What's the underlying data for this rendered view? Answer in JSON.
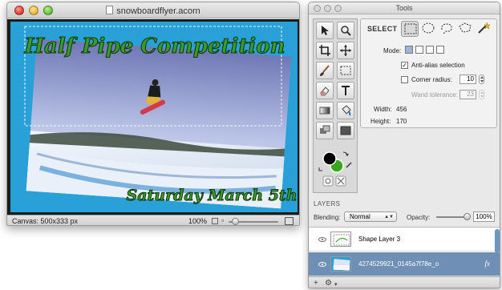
{
  "document_window": {
    "title": "snowboardflyer.acorn",
    "canvas": {
      "headline": "Half Pipe Competition",
      "subline": "Saturday March 5th",
      "headline_color": "#3a9a2a",
      "background_color": "#2aa0d8"
    },
    "status": {
      "canvas_size": "Canvas: 500x333 px",
      "zoom": "100%"
    }
  },
  "tools_window": {
    "title": "Tools",
    "tools": [
      "select-arrow",
      "zoom",
      "crop",
      "move",
      "brush",
      "marquee",
      "eraser",
      "text",
      "gradient",
      "paint-bucket",
      "clone",
      "rectangle-shape"
    ],
    "colors": {
      "foreground": "#000000",
      "background": "#3aa81e"
    },
    "options": {
      "select_label": "SELECT",
      "mode_label": "Mode:",
      "antialias_label": "Anti-alias selection",
      "antialias_checked": true,
      "corner_radius_label": "Corner radius:",
      "corner_radius_checked": false,
      "corner_radius_value": "10",
      "wand_tolerance_label": "Wand tolerance:",
      "wand_tolerance_value": "23",
      "width_label": "Width:",
      "width_value": "456",
      "height_label": "Height:",
      "height_value": "170"
    },
    "layers": {
      "title": "LAYERS",
      "blending_label": "Blending:",
      "blending_value": "Normal",
      "opacity_label": "Opacity:",
      "opacity_value": "100%",
      "items": [
        {
          "name": "Shape Layer 3",
          "selected": false
        },
        {
          "name": "4274529921_0145a7f78e_o",
          "selected": true,
          "fx": "fx"
        }
      ],
      "footer": {
        "add_label": "+",
        "gear_label": "⚙"
      }
    }
  }
}
